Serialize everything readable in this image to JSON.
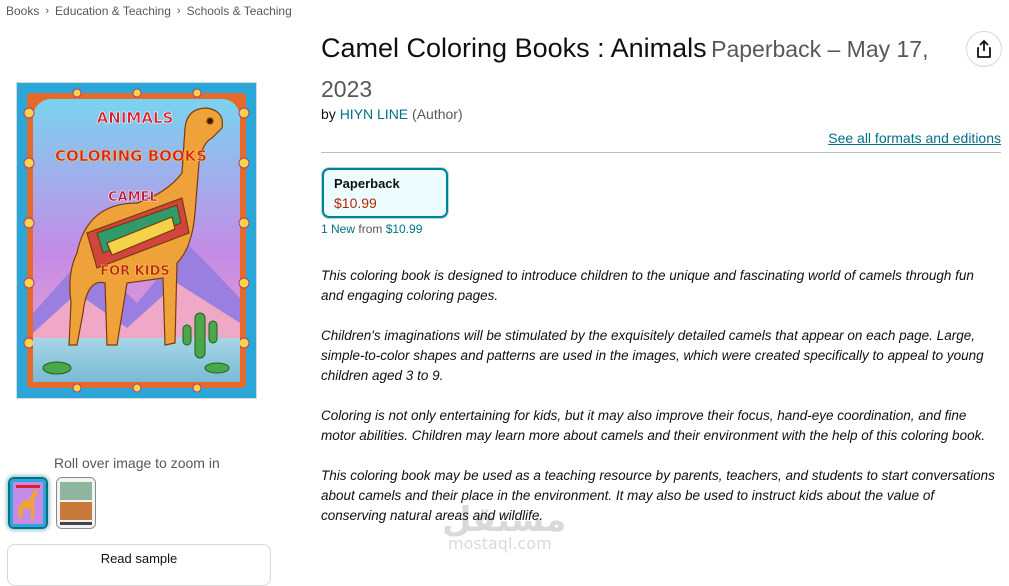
{
  "breadcrumb": [
    "Books",
    "Education & Teaching",
    "Schools & Teaching"
  ],
  "product": {
    "title": "Camel Coloring Books : Animals",
    "subtitle": "Paperback – May 17, 2023",
    "by_label": "by",
    "author": "HIYN LINE",
    "author_role": "(Author)",
    "see_all": "See all formats and editions"
  },
  "cover": {
    "title_line1": "ANIMALS",
    "title_line2": "COLORING BOOKS",
    "title_line3": "CAMEL",
    "title_line4": "FOR KIDS"
  },
  "gallery": {
    "roll_over": "Roll over image to zoom in",
    "read_sample": "Read sample"
  },
  "format": {
    "name": "Paperback",
    "price": "$10.99",
    "new_count": "1 New",
    "new_from": "from",
    "new_price": "$10.99"
  },
  "description": [
    "This coloring book is designed to introduce children to the unique and fascinating world of camels through fun and engaging coloring pages.",
    "Children's imaginations will be stimulated by the exquisitely detailed camels that appear on each page. Large, simple-to-color shapes and patterns are used in the images, which were created specifically to appeal to young children aged 3 to 9.",
    "Coloring is not only entertaining for kids, but it may also improve their focus, hand-eye coordination, and fine motor abilities. Children may learn more about camels and their environment with the help of this coloring book.",
    "This coloring book may be used as a teaching resource by parents, teachers, and students to start conversations about camels and their place in the environment. It may also be used to instruct kids about the value of conserving natural areas and wildlife."
  ],
  "watermark": {
    "brand_ar": "مستقل",
    "brand_url": "mostaql.com"
  },
  "colors": {
    "link": "#007185",
    "price": "#b12704",
    "accent": "#008296"
  },
  "icons": {
    "share": "share-icon",
    "breadcrumb_sep": "chevron-right-icon"
  }
}
